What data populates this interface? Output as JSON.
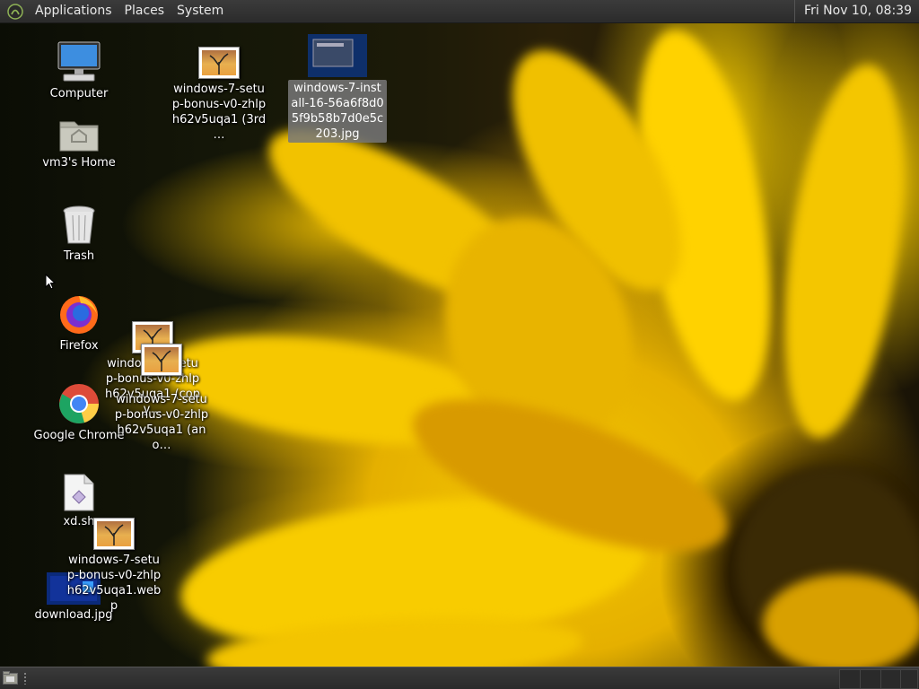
{
  "top_panel": {
    "menus": [
      "Applications",
      "Places",
      "System"
    ],
    "clock": "Fri Nov 10, 08:39"
  },
  "desktop": {
    "computer": "Computer",
    "home": "vm3's Home",
    "trash": "Trash",
    "firefox": "Firefox",
    "chrome": "Google Chrome",
    "xd": "xd.sh",
    "download": "download.jpg",
    "setup_3rd": "windows-7-setup-bonus-v0-zhlph62v5uqa1 (3rd …",
    "install_jpg": "windows-7-install-16-56a6f8d05f9b58b7d0e5c203.jpg",
    "setup_copy": "windows-7-setup-bonus-v0-zhlph62v5uqa1 (copy…",
    "setup_another": "windows-7-setup-bonus-v0-zhlph62v5uqa1 (ano…",
    "setup_webp": "windows-7-setup-bonus-v0-zhlph62v5uqa1.webp"
  },
  "colors": {
    "panel": "#2f2f2f",
    "selection": "#787878",
    "petal_yellow": "#f4c500"
  }
}
